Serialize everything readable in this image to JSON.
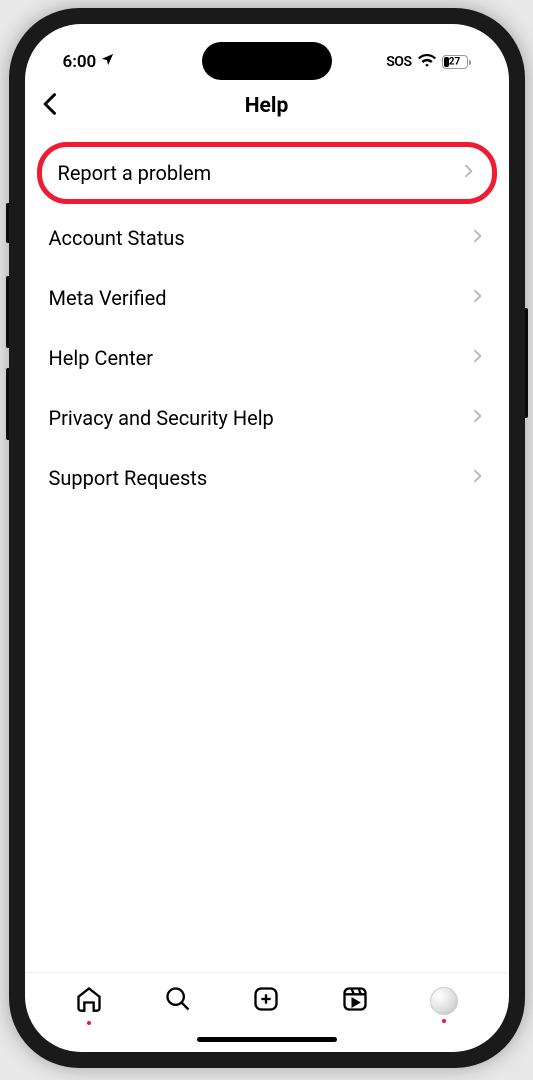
{
  "status": {
    "time": "6:00",
    "sos": "SOS",
    "battery": "27"
  },
  "nav": {
    "title": "Help"
  },
  "menu": {
    "items": [
      {
        "label": "Report a problem",
        "highlighted": true
      },
      {
        "label": "Account Status",
        "highlighted": false
      },
      {
        "label": "Meta Verified",
        "highlighted": false
      },
      {
        "label": "Help Center",
        "highlighted": false
      },
      {
        "label": "Privacy and Security Help",
        "highlighted": false
      },
      {
        "label": "Support Requests",
        "highlighted": false
      }
    ]
  },
  "tabs": {
    "items": [
      {
        "name": "home",
        "dot": true
      },
      {
        "name": "search",
        "dot": false
      },
      {
        "name": "create",
        "dot": false
      },
      {
        "name": "reels",
        "dot": false
      },
      {
        "name": "profile",
        "dot": true
      }
    ]
  }
}
